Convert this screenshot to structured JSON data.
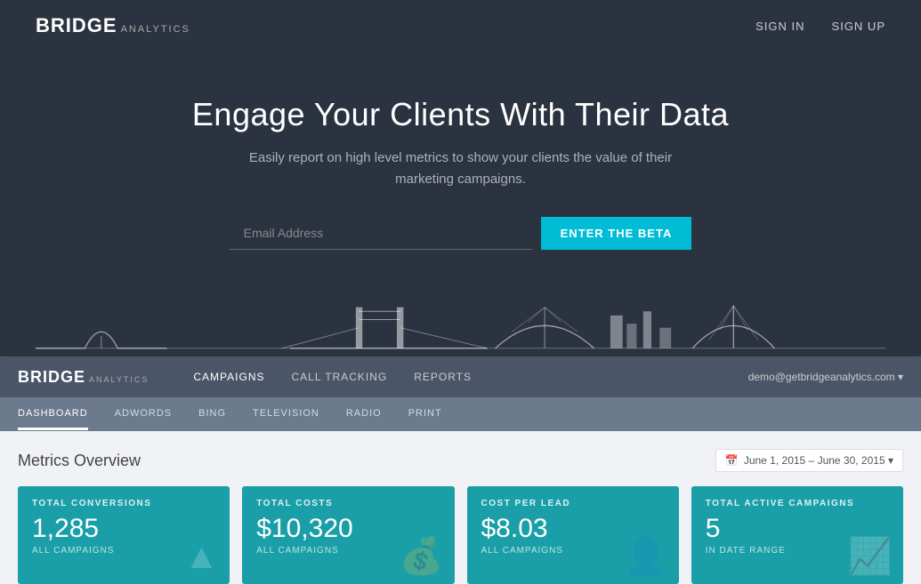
{
  "nav": {
    "brand_bridge": "BRIDGE",
    "brand_analytics": "analytics",
    "sign_in": "SIGN IN",
    "sign_up": "SIGN UP"
  },
  "hero": {
    "headline": "Engage Your Clients With Their Data",
    "subtext": "Easily report on high level metrics to show your clients the value of their marketing campaigns.",
    "email_placeholder": "Email Address",
    "beta_button": "ENTER THE BETA"
  },
  "dashboard": {
    "brand_bridge": "BRIDGE",
    "brand_analytics": "analytics",
    "nav_items": [
      {
        "label": "CAMPAIGNS",
        "active": true
      },
      {
        "label": "CALL TRACKING",
        "active": false
      },
      {
        "label": "REPORTS",
        "active": false
      }
    ],
    "user": "demo@getbridgeanalytics.com ▾",
    "subnav_items": [
      {
        "label": "DASHBOARD",
        "active": true
      },
      {
        "label": "ADWORDS",
        "active": false
      },
      {
        "label": "BING",
        "active": false
      },
      {
        "label": "TELEVISION",
        "active": false
      },
      {
        "label": "RADIO",
        "active": false
      },
      {
        "label": "PRINT",
        "active": false
      }
    ],
    "metrics_title": "Metrics Overview",
    "date_range": "June 1, 2015 – June 30, 2015 ▾",
    "cards": [
      {
        "title": "TOTAL CONVERSIONS",
        "value": "1,285",
        "sub": "ALL CAMPAIGNS"
      },
      {
        "title": "TOTAL COSTS",
        "value": "$10,320",
        "sub": "ALL CAMPAIGNS"
      },
      {
        "title": "COST PER LEAD",
        "value": "$8.03",
        "sub": "ALL CAMPAIGNS"
      },
      {
        "title": "TOTAL ACTIVE CAMPAIGNS",
        "value": "5",
        "sub": "IN DATE RANGE"
      }
    ]
  }
}
